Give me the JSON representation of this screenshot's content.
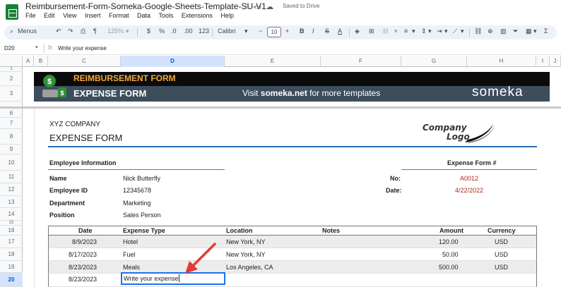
{
  "app": {
    "title": "Reimbursement-Form-Someka-Google-Sheets-Template-SU-V1",
    "saved_status": "Saved to Drive",
    "menu": [
      "File",
      "Edit",
      "View",
      "Insert",
      "Format",
      "Data",
      "Tools",
      "Extensions",
      "Help"
    ]
  },
  "toolbar": {
    "menus_label": "Menus",
    "zoom": "125%",
    "currency": "$",
    "percent": "%",
    "decrease_decimal": ".0",
    "increase_decimal": ".00",
    "number_format": "123",
    "font": "Calibri",
    "font_size": "10",
    "bold": "B",
    "italic": "I",
    "strikethrough": "S",
    "text_color": "A",
    "functions": "Σ"
  },
  "formula_bar": {
    "cell_ref": "D20",
    "fx": "fx",
    "value": "Write your expense"
  },
  "columns": [
    "A",
    "B",
    "C",
    "D",
    "E",
    "F",
    "G",
    "H",
    "I",
    "J"
  ],
  "rows": [
    "1",
    "2",
    "3",
    "6",
    "7",
    "8",
    "9",
    "10",
    "11",
    "12",
    "13",
    "14",
    "15",
    "16",
    "17",
    "18",
    "19",
    "20"
  ],
  "banner": {
    "title": "REIMBURSEMENT FORM",
    "subtitle": "EXPENSE FORM",
    "visit_prefix": "Visit ",
    "visit_link": "someka.net",
    "visit_suffix": " for more templates",
    "brand": "someka"
  },
  "form": {
    "company": "XYZ COMPANY",
    "title": "EXPENSE FORM",
    "logo_line1": "Company",
    "logo_line2": "Logo",
    "employee_section": "Employee Information",
    "expense_form_no_label": "Expense Form #",
    "fields": [
      {
        "label": "Name",
        "value": "Nick Butterfly"
      },
      {
        "label": "Employee ID",
        "value": "12345678"
      },
      {
        "label": "Department",
        "value": "Marketing"
      },
      {
        "label": "Position",
        "value": "Sales Person"
      }
    ],
    "no_label": "No:",
    "no_value": "A0012",
    "date_label": "Date:",
    "date_value": "4/22/2022"
  },
  "table": {
    "headers": {
      "date": "Date",
      "type": "Expense Type",
      "location": "Location",
      "notes": "Notes",
      "amount": "Amount",
      "currency": "Currency"
    },
    "rows": [
      {
        "date": "8/9/2023",
        "type": "Hotel",
        "location": "New York, NY",
        "amount": "120.00",
        "currency": "USD"
      },
      {
        "date": "8/17/2023",
        "type": "Fuel",
        "location": "New York, NY",
        "amount": "50.00",
        "currency": "USD"
      },
      {
        "date": "8/23/2023",
        "type": "Meals",
        "location": "Los Angeles, CA",
        "amount": "500.00",
        "currency": "USD"
      },
      {
        "date": "8/23/2023",
        "type": "Write your expense",
        "location": "",
        "amount": "",
        "currency": ""
      }
    ]
  }
}
